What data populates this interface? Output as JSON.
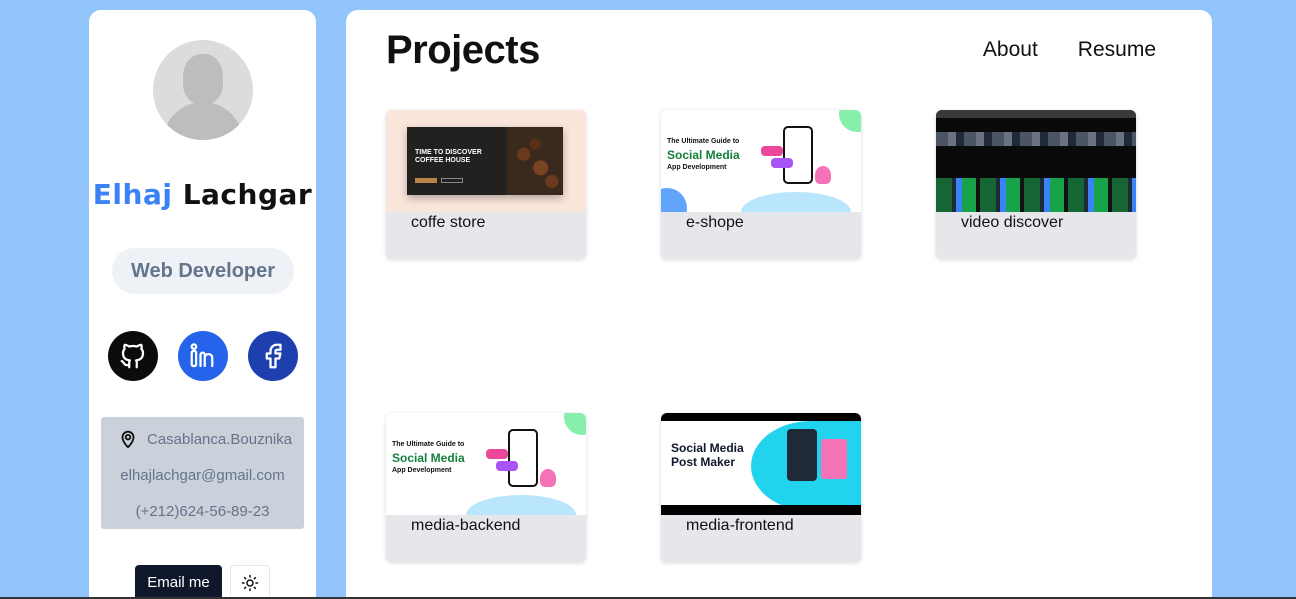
{
  "profile": {
    "first_name": "Elhaj",
    "last_name": "Lachgar",
    "role": "Web Developer",
    "location": "Casablanca.Bouznika",
    "email": "elhajlachgar@gmail.com",
    "phone": "(+212)624-56-89-23",
    "email_button": "Email me",
    "socials": [
      "github-icon",
      "linkedin-icon",
      "facebook-icon"
    ]
  },
  "header": {
    "title": "Projects",
    "nav": [
      "About",
      "Resume"
    ]
  },
  "projects": [
    {
      "label": "coffe store",
      "thumb": {
        "lines": [
          "TIME TO DISCOVER",
          "COFFEE HOUSE"
        ]
      }
    },
    {
      "label": "e-shope",
      "thumb": {
        "lines": [
          "The Ultimate Guide to",
          "Social Media",
          "App Development"
        ]
      }
    },
    {
      "label": "video discover"
    },
    {
      "label": "media-backend",
      "thumb": {
        "lines": [
          "The Ultimate Guide to",
          "Social Media",
          "App Development"
        ]
      }
    },
    {
      "label": "media-frontend",
      "thumb": {
        "lines": [
          "Social Media",
          "Post Maker"
        ]
      }
    }
  ],
  "colors": {
    "background": "#93c5fd",
    "accent": "#3b82f6",
    "linkedin": "#2563eb",
    "facebook": "#1e40af",
    "button": "#0f172a"
  }
}
